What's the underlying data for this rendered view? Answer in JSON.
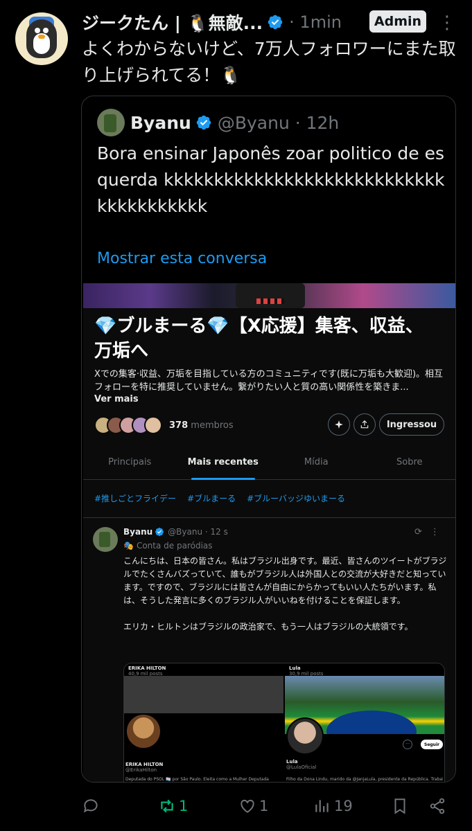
{
  "tweet": {
    "author_name": "ジークたん | 🐧無敵...",
    "time": "· 1min",
    "admin_label": "Admin",
    "more": "⋮",
    "text": "よくわからないけど、7万人フォロワーにまた取り上げられてる！🐧"
  },
  "quote": {
    "name": "Byanu",
    "handle": "@Byanu · 12h",
    "text": "Bora ensinar Japonês zoar politico de esquerda kkkkkkkkkkkkkkkkkkkkkkkkkkkkkkkkkkkkkkk",
    "show_thread": "Mostrar esta conversa"
  },
  "community": {
    "title": "💎ブルまーる💎【X応援】集客、収益、万垢へ",
    "description": "Xでの集客·収益、万垢を目指している方のコミュニティです(既に万垢も大歓迎)。相互フォローを特に推奨していません。繋がりたい人と質の高い関係性を築きま...",
    "see_more": "Ver mais",
    "member_count": "378",
    "member_label": "membros",
    "join_label": "Ingressou",
    "tabs": [
      "Principais",
      "Mais recentes",
      "Mídia",
      "Sobre"
    ],
    "tags": [
      "#推しごとフライデー",
      "#ブルまーる",
      "#ブルーバッジゆいまーる"
    ]
  },
  "post": {
    "name": "Byanu",
    "handle": "@Byanu · 12 s",
    "sub": "Conta de paródias",
    "text": "こんにちは、日本の皆さん。私はブラジル出身です。最近、皆さんのツイートがブラジルでたくさんバズっていて、誰もがブラジル人は外国人との交流が大好きだと知っています。ですので、ブラジルには皆さんが自由にからかってもいい人たちがいます。私は、そうした発言に多くのブラジル人がいいねを付けることを保証します。\n\nエリカ・ヒルトンはブラジルの政治家で、もう一人はブラジルの大統領です。",
    "media_left_title": "ERIKA HILTON",
    "media_left_posts": "40,9 mil posts",
    "media_left_name": "ERIKA HILTON",
    "media_left_handle": "@ErikaHilton",
    "media_left_desc": "Deputada do PSOL 🏳️‍⚧️ por São Paulo. Eleita como a Mulher Deputada Federal",
    "media_right_title": "Lula",
    "media_right_posts": "30,9 mil posts",
    "media_right_name": "Lula",
    "media_right_handle": "@LulaOficial",
    "media_right_desc": "Filho da Dona Lindu, marido da @JanjaLula, presidente da República. Trabalhando",
    "media_right_follow": "Seguir"
  },
  "actions": {
    "replies": "",
    "retweets": "1",
    "likes": "1",
    "views": "19"
  },
  "colors": {
    "accent": "#1d9bf0",
    "retweet": "#00ba7c",
    "muted": "#71767b",
    "border": "#2f3336"
  }
}
